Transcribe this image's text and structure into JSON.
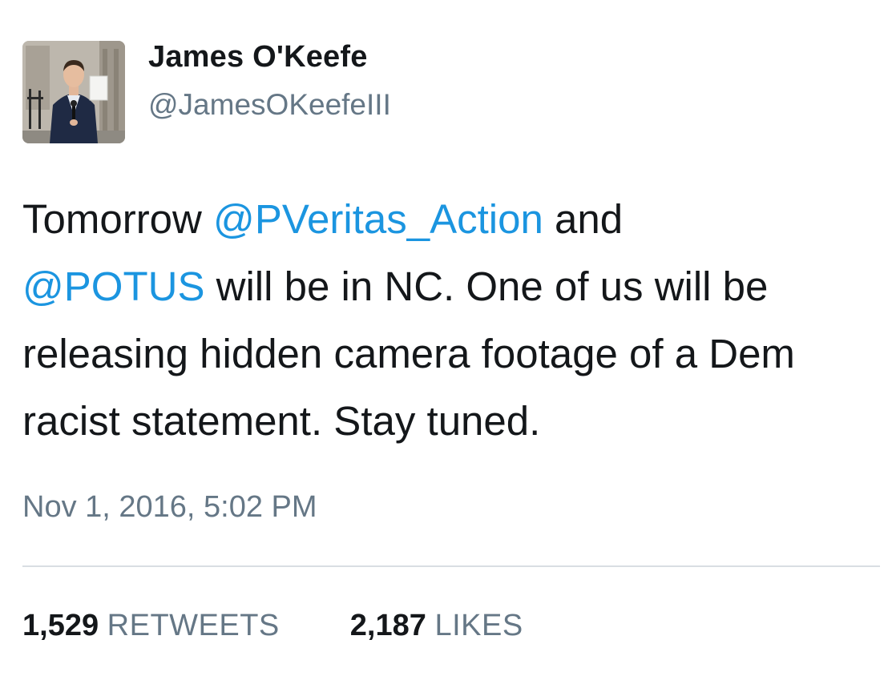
{
  "profile": {
    "display_name": "James O'Keefe",
    "handle": "@JamesOKeefeIII"
  },
  "tweet": {
    "text_segments": [
      {
        "text": "Tomorrow ",
        "type": "text"
      },
      {
        "text": "@PVeritas_Action",
        "type": "mention"
      },
      {
        "text": " and ",
        "type": "text"
      },
      {
        "text": "@POTUS",
        "type": "mention"
      },
      {
        "text": " will be in NC. One of us will be releasing hidden camera footage of a Dem racist statement. Stay tuned.",
        "type": "text"
      }
    ],
    "timestamp": "Nov 1, 2016, 5:02 PM"
  },
  "stats": {
    "retweets_count": "1,529",
    "retweets_label": "RETWEETS",
    "likes_count": "2,187",
    "likes_label": "LIKES"
  },
  "colors": {
    "mention": "#1b95e0",
    "secondary_text": "#657786",
    "primary_text": "#14171a",
    "divider": "#d9dee3"
  }
}
